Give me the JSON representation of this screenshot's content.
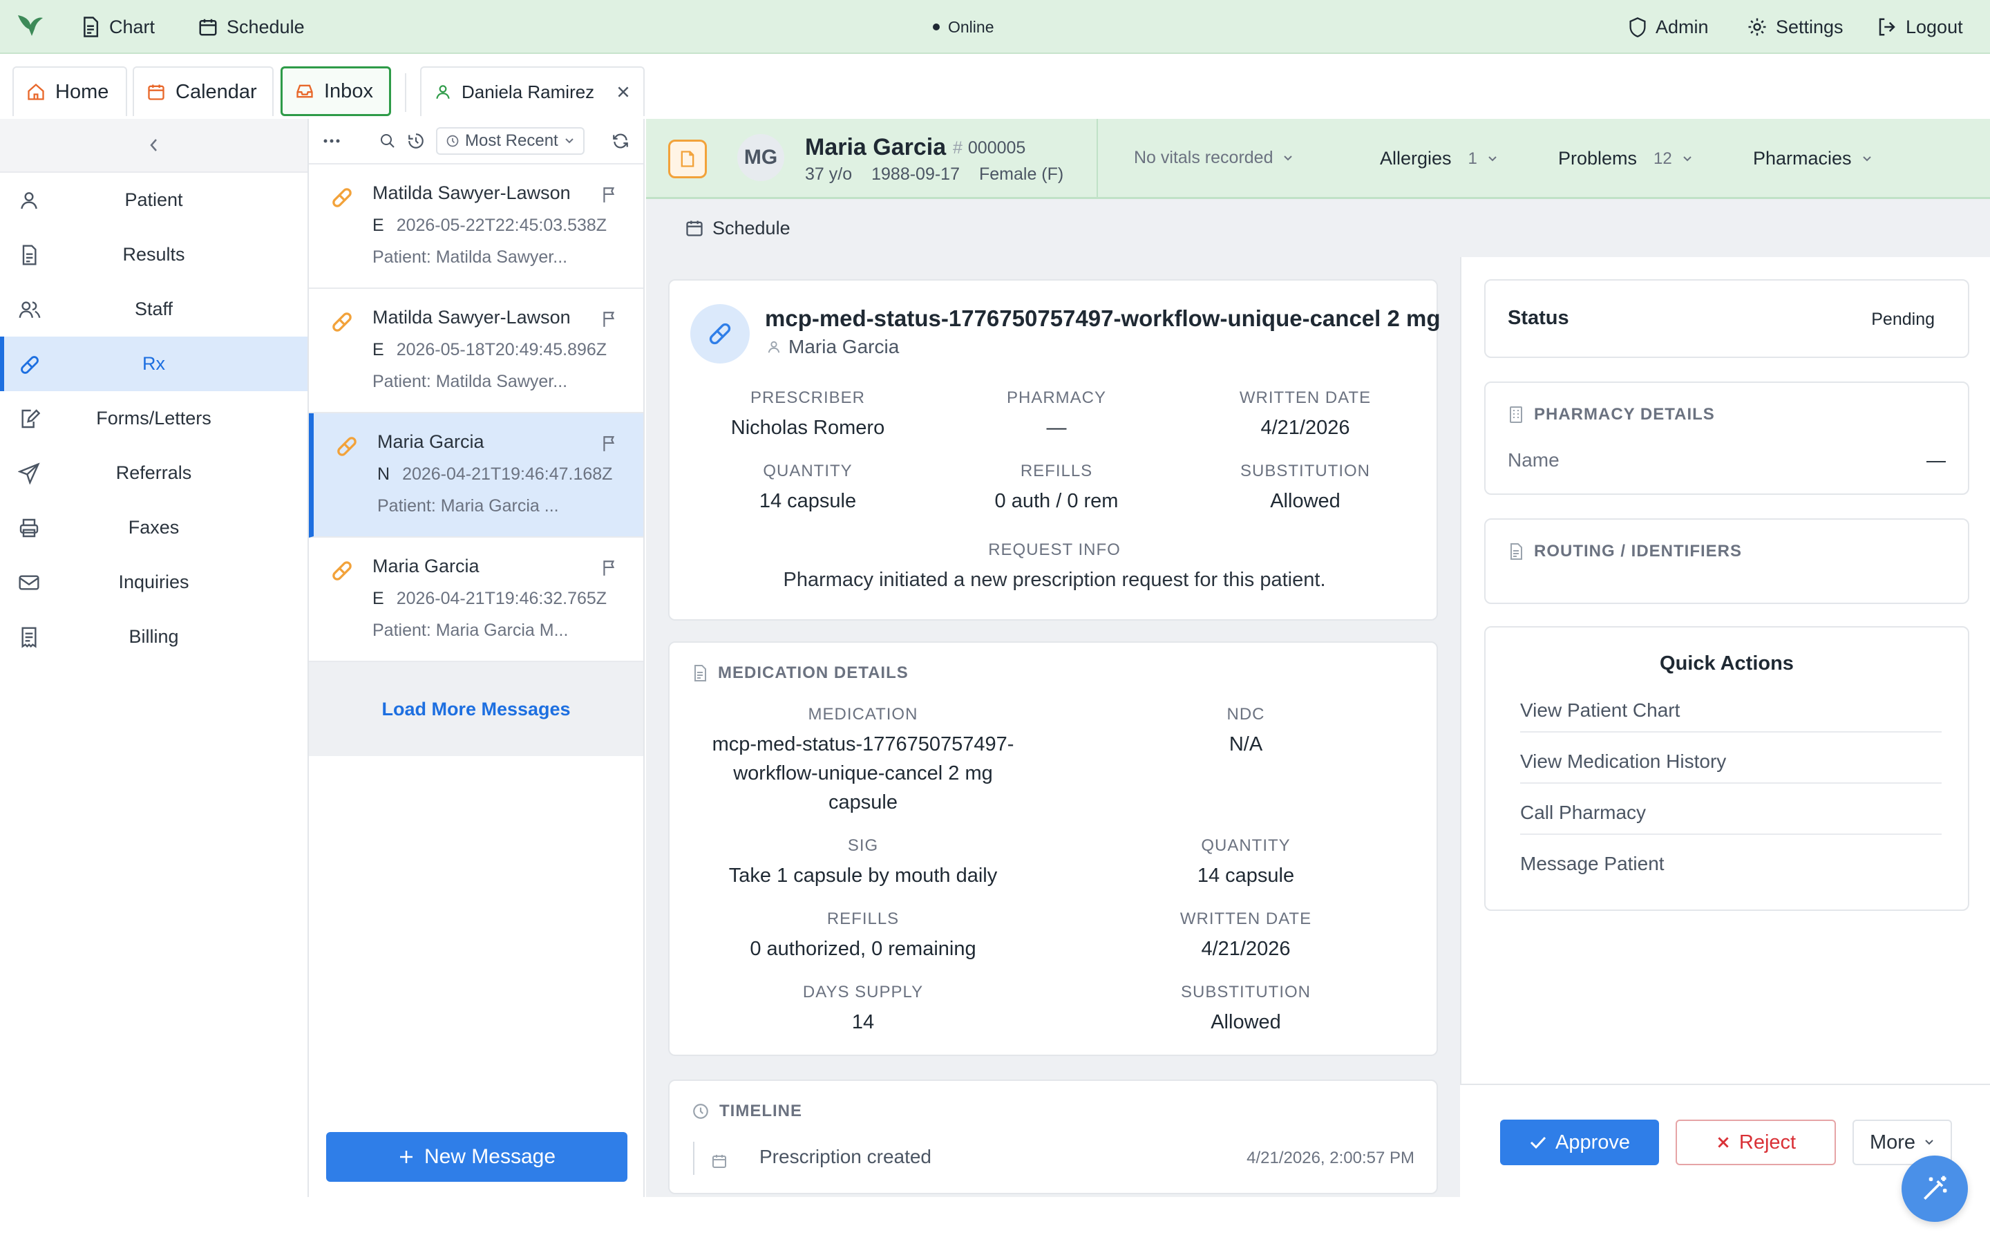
{
  "topbar": {
    "nav": [
      {
        "label": "Chart",
        "icon": "document-icon"
      },
      {
        "label": "Schedule",
        "icon": "calendar-icon"
      }
    ],
    "status": "Online",
    "right": [
      {
        "label": "Admin",
        "icon": "shield-icon"
      },
      {
        "label": "Settings",
        "icon": "gear-icon"
      },
      {
        "label": "Logout",
        "icon": "logout-icon"
      }
    ]
  },
  "tabs": [
    {
      "label": "Home",
      "icon": "home-icon"
    },
    {
      "label": "Calendar",
      "icon": "calendar-icon"
    },
    {
      "label": "Inbox",
      "icon": "inbox-icon",
      "active": true
    },
    {
      "label": "Daniela Ramirez",
      "icon": "user-icon",
      "closable": true
    }
  ],
  "sidebar": {
    "items": [
      {
        "label": "Patient",
        "icon": "user-icon"
      },
      {
        "label": "Results",
        "icon": "document-icon"
      },
      {
        "label": "Staff",
        "icon": "users-icon"
      },
      {
        "label": "Rx",
        "icon": "pill-icon",
        "active": true
      },
      {
        "label": "Forms/Letters",
        "icon": "form-edit-icon"
      },
      {
        "label": "Referrals",
        "icon": "send-icon"
      },
      {
        "label": "Faxes",
        "icon": "printer-icon"
      },
      {
        "label": "Inquiries",
        "icon": "mail-icon"
      },
      {
        "label": "Billing",
        "icon": "receipt-icon"
      }
    ]
  },
  "messages": {
    "sort_label": "Most Recent",
    "items": [
      {
        "name": "Matilda Sawyer-Lawson",
        "prefix": "E",
        "timestamp": "2026-05-22T22:45:03.538Z",
        "patient": "Patient: Matilda Sawyer..."
      },
      {
        "name": "Matilda Sawyer-Lawson",
        "prefix": "E",
        "timestamp": "2026-05-18T20:49:45.896Z",
        "patient": "Patient: Matilda Sawyer..."
      },
      {
        "name": "Maria Garcia",
        "prefix": "N",
        "timestamp": "2026-04-21T19:46:47.168Z",
        "patient": "Patient: Maria Garcia ...",
        "selected": true
      },
      {
        "name": "Maria Garcia",
        "prefix": "E",
        "timestamp": "2026-04-21T19:46:32.765Z",
        "patient": "Patient: Maria Garcia M..."
      }
    ],
    "load_more": "Load More Messages",
    "new_message": "New Message"
  },
  "patient_header": {
    "initials": "MG",
    "name": "Maria Garcia",
    "mrn": "000005",
    "age": "37 y/o",
    "dob": "1988-09-17",
    "sex": "Female (F)",
    "vitals": "No vitals recorded",
    "allergies_label": "Allergies",
    "allergies_count": "1",
    "problems_label": "Problems",
    "problems_count": "12",
    "pharmacies_label": "Pharmacies"
  },
  "subbar": {
    "schedule_label": "Schedule"
  },
  "rx": {
    "title": "mcp-med-status-1776750757497-workflow-unique-cancel 2 mg",
    "patient": "Maria Garcia",
    "prescriber_label": "PRESCRIBER",
    "prescriber": "Nicholas Romero",
    "pharmacy_label": "PHARMACY",
    "pharmacy": "—",
    "written_label": "WRITTEN DATE",
    "written": "4/21/2026",
    "quantity_label": "QUANTITY",
    "quantity": "14 capsule",
    "refills_label": "REFILLS",
    "refills": "0 auth / 0 rem",
    "substitution_label": "SUBSTITUTION",
    "substitution": "Allowed",
    "request_label": "REQUEST INFO",
    "request": "Pharmacy initiated a new prescription request for this patient."
  },
  "med_details": {
    "title": "MEDICATION DETAILS",
    "medication_label": "MEDICATION",
    "medication_l1": "mcp-med-status-1776750757497-",
    "medication_l2": "workflow-unique-cancel 2 mg",
    "medication_l3": "capsule",
    "ndc_label": "NDC",
    "ndc": "N/A",
    "sig_label": "SIG",
    "sig": "Take 1 capsule by mouth daily",
    "quantity_label": "QUANTITY",
    "quantity": "14 capsule",
    "refills_label": "REFILLS",
    "refills": "0 authorized, 0 remaining",
    "written_label": "WRITTEN DATE",
    "written": "4/21/2026",
    "days_label": "DAYS SUPPLY",
    "days": "14",
    "substitution_label": "SUBSTITUTION",
    "substitution": "Allowed"
  },
  "timeline": {
    "title": "TIMELINE",
    "event": "Prescription created",
    "time": "4/21/2026, 2:00:57 PM"
  },
  "right_panel": {
    "status_label": "Status",
    "status_value": "Pending",
    "pharmacy_title": "PHARMACY DETAILS",
    "pharmacy_name_label": "Name",
    "pharmacy_name_value": "—",
    "routing_title": "ROUTING / IDENTIFIERS",
    "quick_actions_title": "Quick Actions",
    "quick_actions": [
      "View Patient Chart",
      "View Medication History",
      "Call Pharmacy",
      "Message Patient"
    ]
  },
  "actions": {
    "approve": "Approve",
    "reject": "Reject",
    "more": "More"
  },
  "colors": {
    "brand_green": "#dff1e2",
    "accent_blue": "#2f7ee8",
    "reject_red": "#d93036",
    "pill_orange": "#f2a23a"
  }
}
